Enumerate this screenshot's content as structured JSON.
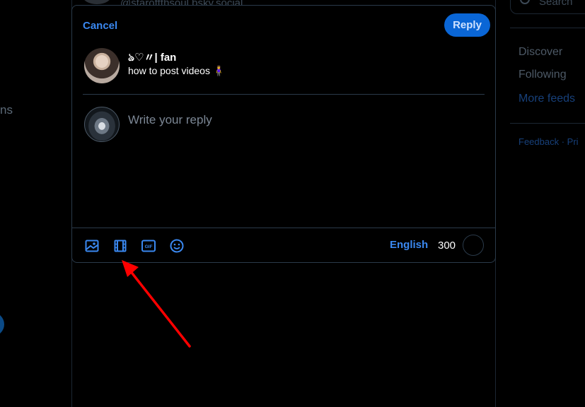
{
  "background": {
    "feed_handle": "@staroftthsoul.bsky.social",
    "left_nav_fragment": "ns",
    "right_sidebar": {
      "search_placeholder": "Search",
      "feeds": [
        "Discover",
        "Following"
      ],
      "more_feeds": "More feeds",
      "footer": "Feedback · Pri"
    }
  },
  "composer": {
    "cancel_label": "Cancel",
    "reply_label": "Reply",
    "quoted_post": {
      "author_name": "ঌ♡〃| fan",
      "text": "how to post videos 🧍‍♀️"
    },
    "reply_placeholder": "Write your reply",
    "toolbar": {
      "tools": [
        "image-icon",
        "video-icon",
        "gif-icon",
        "emoji-icon"
      ],
      "language": "English",
      "char_remaining": "300"
    }
  },
  "annotation": {
    "arrow_color": "#ff0000",
    "points_to": "video-icon"
  },
  "colors": {
    "accent": "#3a88f0",
    "reply_button": "#0a66d6",
    "border": "#2a3a4a",
    "background": "#000000"
  }
}
